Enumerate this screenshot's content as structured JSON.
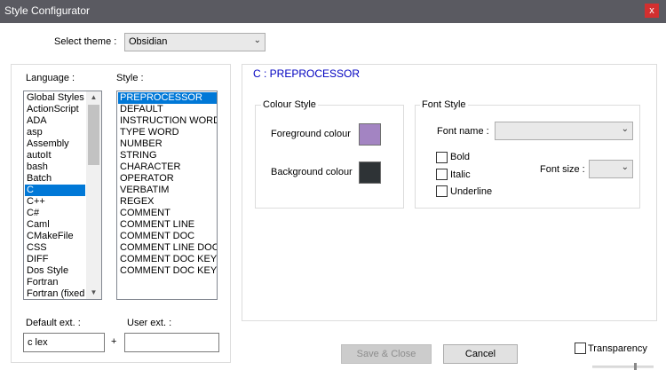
{
  "window": {
    "title": "Style Configurator",
    "close_glyph": "x"
  },
  "theme": {
    "label": "Select theme :",
    "value": "Obsidian"
  },
  "language": {
    "label": "Language :",
    "items": [
      "Global Styles",
      "ActionScript",
      "ADA",
      "asp",
      "Assembly",
      "autoIt",
      "bash",
      "Batch",
      "C",
      "C++",
      "C#",
      "Caml",
      "CMakeFile",
      "CSS",
      "DIFF",
      "Dos Style",
      "Fortran",
      "Fortran (fixed"
    ],
    "selected_index": 8
  },
  "style": {
    "label": "Style :",
    "items": [
      "PREPROCESSOR",
      "DEFAULT",
      "INSTRUCTION WORD",
      "TYPE WORD",
      "NUMBER",
      "STRING",
      "CHARACTER",
      "OPERATOR",
      "VERBATIM",
      "REGEX",
      "COMMENT",
      "COMMENT LINE",
      "COMMENT DOC",
      "COMMENT LINE DOC",
      "COMMENT DOC KEYWO",
      "COMMENT DOC KEYWO"
    ],
    "selected_index": 0
  },
  "ext": {
    "default_label": "Default ext. :",
    "default_value": "c lex",
    "user_label": "User ext. :",
    "user_value": "",
    "plus": "+"
  },
  "header": "C : PREPROCESSOR",
  "colour_style": {
    "title": "Colour Style",
    "foreground_label": "Foreground colour",
    "background_label": "Background colour",
    "foreground_color": "#a384c2",
    "background_color": "#2e3336"
  },
  "font_style": {
    "title": "Font Style",
    "font_name_label": "Font name :",
    "font_name_value": "",
    "bold_label": "Bold",
    "italic_label": "Italic",
    "underline_label": "Underline",
    "font_size_label": "Font size :",
    "font_size_value": ""
  },
  "buttons": {
    "save_close": "Save & Close",
    "cancel": "Cancel"
  },
  "transparency": {
    "label": "Transparency",
    "checked": false
  },
  "colors": {
    "title_bar": "#5a5a61",
    "selection": "#0078d7",
    "header_text": "#0000c0",
    "close_button": "#d32f2f"
  }
}
